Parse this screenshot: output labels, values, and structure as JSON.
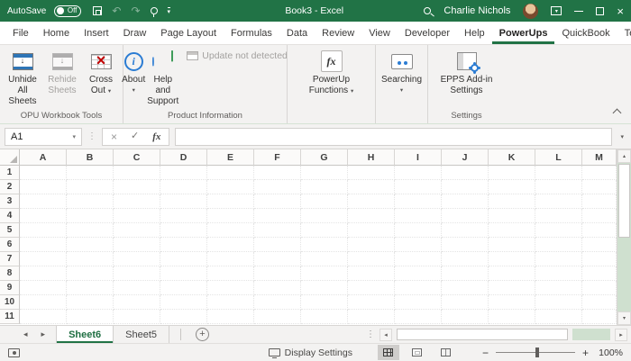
{
  "colors": {
    "excel_green": "#217346",
    "accent_blue": "#2b7cd3",
    "crossout_red": "#c00000",
    "scrollbar_green": "#cfe0cf"
  },
  "title_bar": {
    "autosave_label": "AutoSave",
    "autosave_state": "Off",
    "document_title": "Book3 - Excel",
    "user_name": "Charlie Nichols"
  },
  "ribbon_tabs": {
    "items": [
      {
        "label": "File",
        "active": false
      },
      {
        "label": "Home",
        "active": false
      },
      {
        "label": "Insert",
        "active": false
      },
      {
        "label": "Draw",
        "active": false
      },
      {
        "label": "Page Layout",
        "active": false
      },
      {
        "label": "Formulas",
        "active": false
      },
      {
        "label": "Data",
        "active": false
      },
      {
        "label": "Review",
        "active": false
      },
      {
        "label": "View",
        "active": false
      },
      {
        "label": "Developer",
        "active": false
      },
      {
        "label": "Help",
        "active": false
      },
      {
        "label": "PowerUps",
        "active": true
      },
      {
        "label": "QuickBook",
        "active": false
      },
      {
        "label": "Team",
        "active": false
      }
    ]
  },
  "ribbon": {
    "groups": {
      "workbook_tools": {
        "label": "OPU Workbook Tools",
        "unhide_button": "Unhide All Sheets",
        "rehide_button": "Rehide Sheets",
        "crossout_button": "Cross Out"
      },
      "product_information": {
        "label": "Product Information",
        "about_button": "About",
        "help_button": "Help and Support",
        "update_status": "Update not detected"
      },
      "powerup_functions": {
        "label": "",
        "button": "PowerUp Functions"
      },
      "searching": {
        "label": "",
        "button": "Searching"
      },
      "settings": {
        "label": "Settings",
        "button": "EPPS Add-in Settings"
      }
    }
  },
  "formula_bar": {
    "name_box_value": "A1",
    "formula_value": "",
    "fx_label": "fx"
  },
  "grid": {
    "columns": [
      "A",
      "B",
      "C",
      "D",
      "E",
      "F",
      "G",
      "H",
      "I",
      "J",
      "K",
      "L",
      "M"
    ],
    "rows": [
      "1",
      "2",
      "3",
      "4",
      "5",
      "6",
      "7",
      "8",
      "9",
      "10",
      "11"
    ]
  },
  "sheet_tabs": {
    "items": [
      {
        "label": "Sheet6",
        "active": true
      },
      {
        "label": "Sheet5",
        "active": false
      }
    ]
  },
  "status_bar": {
    "display_settings_label": "Display Settings",
    "zoom_value": "100%"
  },
  "glyphs": {
    "undo": "↶",
    "redo": "↷",
    "dropdown": "▾",
    "cancel": "×",
    "check": "✓",
    "vdots": "⋮",
    "prev": "◂",
    "next": "▸",
    "up": "▴",
    "down": "▾",
    "minus": "−",
    "plus": "+",
    "close": "×",
    "add_sheet": "+",
    "info_i": "i",
    "fx": "fx"
  }
}
